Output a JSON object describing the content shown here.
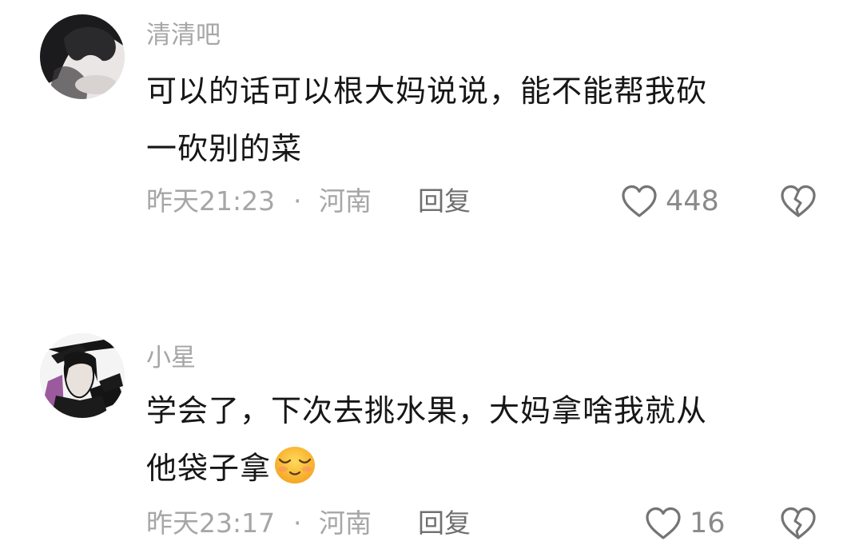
{
  "comments": [
    {
      "username": "清清吧",
      "text_line1": "可以的话可以根大妈说说，能不能帮我砍",
      "text_line2": "一砍别的菜",
      "time": "昨天21:23",
      "separator": "·",
      "location": "河南",
      "reply_label": "回复",
      "likes": "448",
      "avatar_icon": "user-photo-avatar",
      "like_icon": "heart-outline-icon",
      "dislike_icon": "broken-heart-icon"
    },
    {
      "username": "小星",
      "text_line1": "学会了，下次去挑水果，大妈拿啥我就从",
      "text_line2": "他袋子拿",
      "time": "昨天23:17",
      "separator": "·",
      "location": "河南",
      "reply_label": "回复",
      "likes": "16",
      "avatar_icon": "anime-character-avatar",
      "emoji": "content-smile-emoji",
      "like_icon": "heart-outline-icon",
      "dislike_icon": "broken-heart-icon"
    }
  ]
}
